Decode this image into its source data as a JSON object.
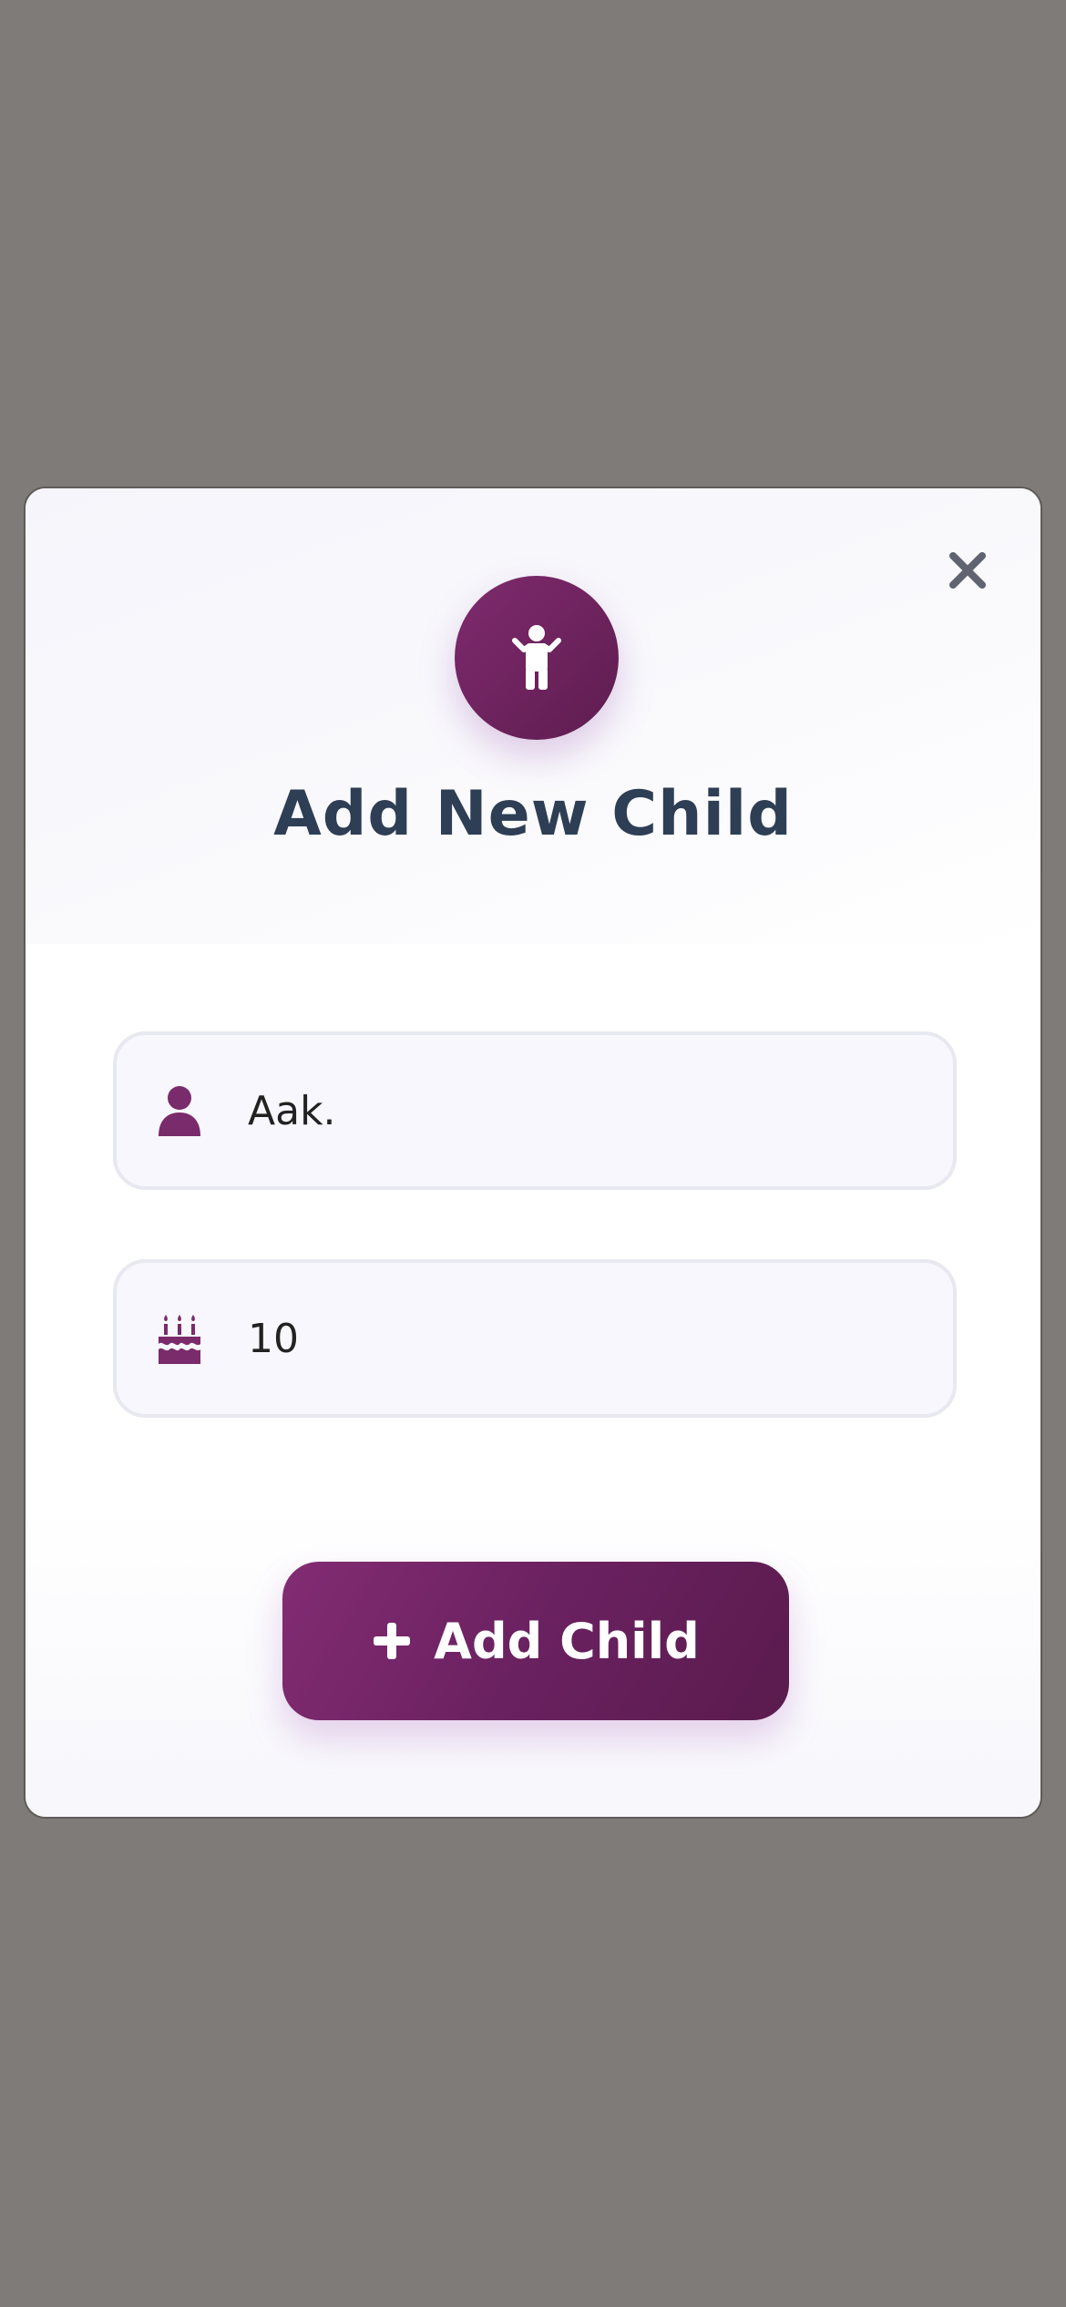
{
  "modal": {
    "title": "Add New Child",
    "close_icon": "close-icon",
    "header_icon": "child-icon"
  },
  "form": {
    "name": {
      "icon": "user-icon",
      "value": "Aak."
    },
    "age": {
      "icon": "birthday-cake-icon",
      "value": "10"
    }
  },
  "submit": {
    "icon": "plus-icon",
    "label": "Add Child"
  },
  "colors": {
    "accent": "#6e2462",
    "title": "#2e3e54",
    "overlay": "#7f7b79",
    "field_bg": "#f7f7fd"
  }
}
